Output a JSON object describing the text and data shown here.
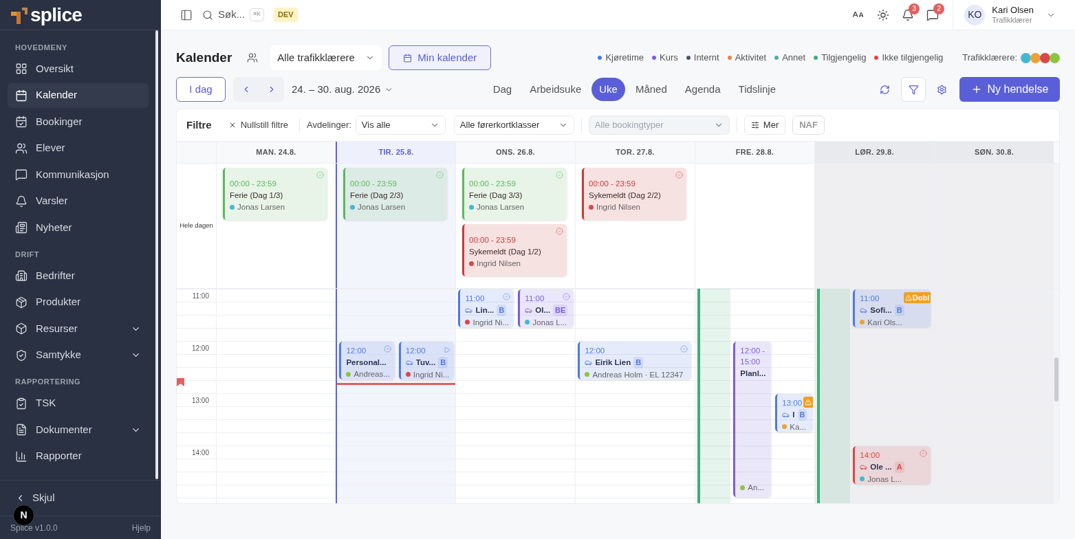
{
  "sidebar": {
    "logo": "splice",
    "sections": [
      {
        "title": "HOVEDMENY",
        "items": [
          {
            "label": "Oversikt",
            "selected": false
          },
          {
            "label": "Kalender",
            "selected": true
          },
          {
            "label": "Bookinger",
            "selected": false
          },
          {
            "label": "Elever",
            "selected": false
          },
          {
            "label": "Kommunikasjon",
            "selected": false
          },
          {
            "label": "Varsler",
            "selected": false
          },
          {
            "label": "Nyheter",
            "selected": false
          }
        ]
      },
      {
        "title": "DRIFT",
        "items": [
          {
            "label": "Bedrifter",
            "selected": false
          },
          {
            "label": "Produkter",
            "selected": false
          },
          {
            "label": "Resurser",
            "selected": false,
            "expanded": false
          },
          {
            "label": "Samtykke",
            "selected": false,
            "expanded": false
          }
        ]
      },
      {
        "title": "RAPPORTERING",
        "items": [
          {
            "label": "TSK",
            "selected": false
          },
          {
            "label": "Dokumenter",
            "selected": false,
            "expanded": false
          },
          {
            "label": "Rapporter",
            "selected": false
          }
        ]
      }
    ],
    "collapse": "Skjul",
    "version": "Splice v1.0.0",
    "help": "Hjelp",
    "dev_indicator": "N"
  },
  "topbar": {
    "search": {
      "placeholder": "Søk...",
      "shortcut": "⌘K"
    },
    "env_badge": "DEV",
    "notifications": "3",
    "messages": "2",
    "user": {
      "initials": "KO",
      "name": "Kari Olsen",
      "role": "Trafikklærer"
    }
  },
  "title": "Kalender",
  "instructor_select": "Alle trafikklærere",
  "my_calendar": "Min kalender",
  "legend": [
    {
      "label": "Kjøretime",
      "color": "#4f7be0"
    },
    {
      "label": "Kurs",
      "color": "#7c5cdc"
    },
    {
      "label": "Internt",
      "color": "#4b5563"
    },
    {
      "label": "Aktivitet",
      "color": "#e8853c"
    },
    {
      "label": "Annet",
      "color": "#4fae9a"
    },
    {
      "label": "Tilgjengelig",
      "color": "#3fae77"
    },
    {
      "label": "Ikke tilgjengelig",
      "color": "#d94848"
    }
  ],
  "instructors": {
    "label": "Trafikklærere:",
    "people": [
      {
        "color": "#45b8d0"
      },
      {
        "color": "#e8a43a"
      },
      {
        "color": "#d94848"
      },
      {
        "color": "#8cc63f"
      }
    ]
  },
  "today_button": "I dag",
  "date_range": "24. – 30. aug. 2026",
  "views": [
    {
      "label": "Dag",
      "selected": false
    },
    {
      "label": "Arbeidsuke",
      "selected": false
    },
    {
      "label": "Uke",
      "selected": true
    },
    {
      "label": "Måned",
      "selected": false
    },
    {
      "label": "Agenda",
      "selected": false
    },
    {
      "label": "Tidslinje",
      "selected": false
    }
  ],
  "new_event": "Ny hendelse",
  "filters": {
    "title": "Filtre",
    "reset": "Nullstill filtre",
    "departments_label": "Avdelinger:",
    "departments": {
      "value": "Vis alle",
      "disabled": false
    },
    "license_classes": {
      "value": "Alle førerkortklasser",
      "disabled": false
    },
    "booking_types": {
      "placeholder": "Alle bookingtyper",
      "disabled": true
    },
    "more": "Mer",
    "naf": "NAF"
  },
  "all_day_label": "Hele dagen",
  "hours": [
    "11:00",
    "12:00",
    "13:00",
    "14:00"
  ],
  "days": [
    {
      "label": "MAN. 24.8.",
      "today": false,
      "weekend": false,
      "all_day": [
        {
          "time": "00:00 - 23:59",
          "title": "Ferie (Dag 1/3)",
          "person": {
            "name": "Jonas Larsen",
            "color": "#45b8d0"
          },
          "color": "#5cb85c",
          "status": {
            "kind": "check"
          }
        }
      ]
    },
    {
      "label": "TIR. 25.8.",
      "today": true,
      "weekend": false,
      "all_day": [
        {
          "time": "00:00 - 23:59",
          "title": "Ferie (Dag 2/3)",
          "person": {
            "name": "Jonas Larsen",
            "color": "#45b8d0"
          },
          "color": "#5cb85c",
          "status": {
            "kind": "check"
          }
        }
      ],
      "events": [
        {
          "kind": "event",
          "time": "12:00",
          "title": "Personal...",
          "vehicle": false,
          "person": {
            "name": "Andreas...",
            "color": "#8cc63f"
          },
          "color": "#4f7be0",
          "status": {
            "kind": "check"
          }
        },
        {
          "kind": "event",
          "time": "12:00",
          "title": "Tuv...",
          "badge": "B",
          "vehicle": true,
          "person": {
            "name": "Ingrid Ni...",
            "color": "#d94848"
          },
          "color": "#4f7be0",
          "status": {
            "kind": "play"
          }
        }
      ]
    },
    {
      "label": "ONS. 26.8.",
      "today": false,
      "weekend": false,
      "all_day": [
        {
          "time": "00:00 - 23:59",
          "title": "Ferie (Dag 3/3)",
          "person": {
            "name": "Jonas Larsen",
            "color": "#45b8d0"
          },
          "color": "#5cb85c",
          "status": {
            "kind": "check"
          }
        },
        {
          "time": "00:00 - 23:59",
          "title": "Sykemeldt (Dag 1/2)",
          "person": {
            "name": "Ingrid Nilsen",
            "color": "#d94848"
          },
          "color": "#c93a3a",
          "status": {
            "kind": "check"
          }
        }
      ],
      "events": [
        {
          "kind": "event",
          "time": "11:00",
          "title": "Lin...",
          "badge": "B",
          "vehicle": true,
          "person": {
            "name": "Ingrid Ni...",
            "color": "#d94848"
          },
          "color": "#4f7be0",
          "status": {
            "kind": "check"
          }
        },
        {
          "kind": "event",
          "time": "11:00",
          "title": "Ol...",
          "badge": "BE",
          "vehicle": true,
          "person": {
            "name": "Jonas L...",
            "color": "#45b8d0"
          },
          "color": "#7c5cdc",
          "status": {
            "kind": "check"
          }
        }
      ]
    },
    {
      "label": "TOR. 27.8.",
      "today": false,
      "weekend": false,
      "all_day": [
        {
          "time": "00:00 - 23:59",
          "title": "Sykemeldt (Dag 2/2)",
          "person": {
            "name": "Ingrid Nilsen",
            "color": "#d94848"
          },
          "color": "#c93a3a",
          "status": {
            "kind": "check"
          }
        }
      ],
      "events": [
        {
          "kind": "event",
          "time": "12:00",
          "title": "Eirik Lien",
          "badge": "B",
          "vehicle": true,
          "person": {
            "name": "Andreas Holm · EL 12347",
            "color": "#8cc63f"
          },
          "color": "#4f7be0",
          "status": {
            "kind": "check"
          }
        }
      ]
    },
    {
      "label": "FRE. 28.8.",
      "today": false,
      "weekend": false,
      "events": [
        {
          "kind": "availability",
          "color": "#3fae77"
        },
        {
          "kind": "event",
          "time": "12:00 - 15:00",
          "title": "Planl...",
          "vehicle": false,
          "person": {
            "name": "An...",
            "color": "#8cc63f"
          },
          "color": "#7c5cdc"
        },
        {
          "kind": "event",
          "time": "13:00",
          "title": "I",
          "badge": "B",
          "vehicle": true,
          "person": {
            "name": "Ka...",
            "color": "#e8a43a"
          },
          "color": "#4f7be0",
          "status": {
            "kind": "warning"
          }
        }
      ]
    },
    {
      "label": "LØR. 29.8.",
      "today": false,
      "weekend": true,
      "events": [
        {
          "kind": "availability",
          "color": "#3fae77"
        },
        {
          "kind": "event",
          "time": "11:00",
          "title": "Sofi...",
          "badge": "B",
          "vehicle": true,
          "person": {
            "name": "Kari Ols...",
            "color": "#e8a43a"
          },
          "color": "#4f7be0",
          "status": {
            "kind": "warning",
            "label": "Dobl"
          }
        },
        {
          "kind": "event",
          "time": "14:00",
          "title": "Ole ...",
          "badge": "A",
          "vehicle": true,
          "person": {
            "name": "Jonas L...",
            "color": "#45b8d0"
          },
          "color": "#d94848",
          "status": {
            "kind": "check"
          }
        }
      ]
    },
    {
      "label": "SØN. 30.8.",
      "today": false,
      "weekend": true
    }
  ]
}
